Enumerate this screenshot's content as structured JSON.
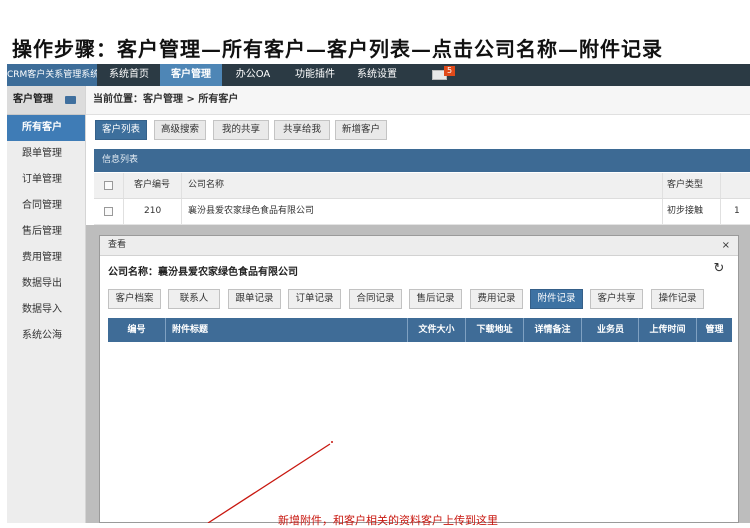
{
  "banner": {
    "title": "操作步骤：客户管理—所有客户—客户列表—点击公司名称—附件记录"
  },
  "topnav": {
    "brand": "CRM客户关系管理系统",
    "items": [
      "系统首页",
      "客户管理",
      "办公OA",
      "功能插件",
      "系统设置"
    ],
    "active": "客户管理",
    "mail_icon": "mail-icon",
    "mail_count": "5"
  },
  "sidebar": {
    "header": "客户管理",
    "toggle_icon": "menu-toggle-icon",
    "items": [
      "所有客户",
      "跟单管理",
      "订单管理",
      "合同管理",
      "售后管理",
      "费用管理",
      "数据导出",
      "数据导入",
      "系统公海"
    ],
    "active": "所有客户"
  },
  "breadcrumb": {
    "text": "当前位置：客户管理 > 所有客户"
  },
  "tabs": [
    "客户列表",
    "高级搜索",
    "我的共享",
    "共享给我",
    "新增客户"
  ],
  "info_list": {
    "label": "信息列表",
    "columns": [
      "客户编号",
      "公司名称",
      "客户类型"
    ],
    "rows": [
      {
        "id": "210",
        "company": "襄汾县爱农家绿色食品有限公司",
        "type": "初步接触",
        "extra": "1"
      }
    ]
  },
  "modal": {
    "title": "查看",
    "close": "×",
    "company_line": "公司名称：襄汾县爱农家绿色食品有限公司",
    "refresh_icon": "refresh-icon",
    "buttons": [
      "客户档案",
      "联系人",
      "跟单记录",
      "订单记录",
      "合同记录",
      "售后记录",
      "费用记录",
      "附件记录",
      "客户共享",
      "操作记录"
    ],
    "active_button": "附件记录",
    "columns": [
      "编号",
      "附件标题",
      "文件大小",
      "下载地址",
      "详情备注",
      "业务员",
      "上传时间",
      "管理"
    ]
  },
  "annotation": {
    "text": "新增附件，和客户相关的资料客户上传到这里"
  },
  "colors": {
    "nav_bg": "#2b3a44",
    "accent": "#3d6f9c",
    "annotation": "#c8170f"
  }
}
